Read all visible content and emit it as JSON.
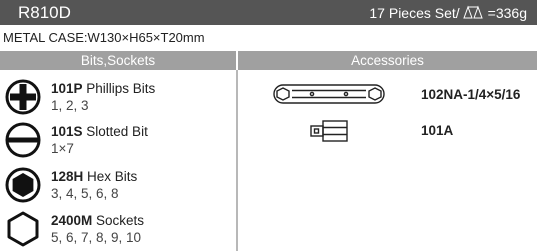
{
  "header": {
    "model": "R810D",
    "pieces_text": "17 Pieces Set/",
    "weight_text": "=336g"
  },
  "case_info": "METAL CASE:W130×H65×T20mm",
  "columns": {
    "left_title": "Bits,Sockets",
    "right_title": "Accessories"
  },
  "bits": [
    {
      "code": "101P",
      "name": " Phillips Bits",
      "sizes": "1, 2, 3",
      "icon": "phillips-icon"
    },
    {
      "code": "101S",
      "name": " Slotted Bit",
      "sizes": "1×7",
      "icon": "slotted-icon"
    },
    {
      "code": "128H",
      "name": " Hex Bits",
      "sizes": "3, 4, 5, 6, 8",
      "icon": "hex-bit-icon"
    },
    {
      "code": "2400M",
      "name": " Sockets",
      "sizes": "5, 6, 7, 8, 9, 10",
      "icon": "socket-icon"
    }
  ],
  "accessories": [
    {
      "code": "102NA-1/4×5/16",
      "icon": "wrench-icon"
    },
    {
      "code": "101A",
      "icon": "adapter-icon"
    }
  ],
  "colors": {
    "header_bg": "#555555",
    "column_header_bg": "#a0a0a0",
    "divider": "#b8b8b8"
  }
}
